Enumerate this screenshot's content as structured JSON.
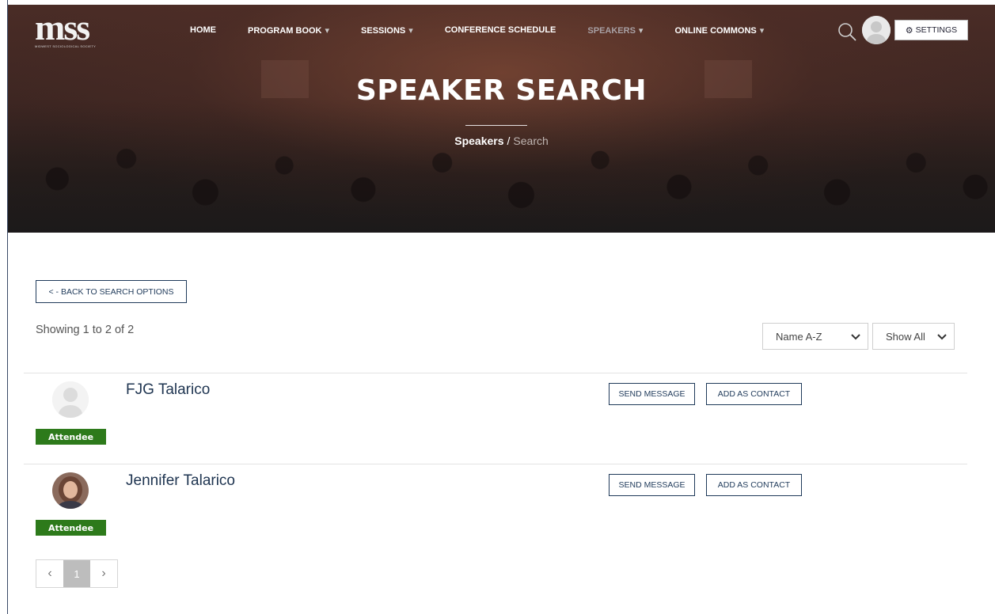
{
  "logo": {
    "text": "mss",
    "subtitle": "MIDWEST SOCIOLOGICAL SOCIETY"
  },
  "nav": {
    "items": [
      {
        "label": "HOME",
        "caret": ""
      },
      {
        "label": "PROGRAM BOOK",
        "caret": "▾"
      },
      {
        "label": "SESSIONS",
        "caret": "▾"
      },
      {
        "label": "CONFERENCE SCHEDULE",
        "caret": ""
      },
      {
        "label": "SPEAKERS",
        "caret": "▾"
      },
      {
        "label": "ONLINE COMMONS",
        "caret": "▾"
      }
    ],
    "settings_label": "SETTINGS",
    "settings_icon": "gear-icon",
    "search_icon": "search-icon"
  },
  "hero": {
    "title": "SPEAKER SEARCH",
    "breadcrumb": {
      "link": "Speakers",
      "separator": "/",
      "current": "Search"
    }
  },
  "content": {
    "back_label": "< - BACK TO SEARCH OPTIONS",
    "showing": "Showing 1 to 2 of 2",
    "sort": {
      "selected": "Name A-Z"
    },
    "filter": {
      "selected": "Show All"
    }
  },
  "speakers": [
    {
      "name": "FJG Talarico",
      "badge": "Attendee",
      "send_label": "SEND MESSAGE",
      "contact_label": "ADD AS CONTACT"
    },
    {
      "name": "Jennifer Talarico",
      "badge": "Attendee",
      "send_label": "SEND MESSAGE",
      "contact_label": "ADD AS CONTACT"
    }
  ],
  "pagination": {
    "prev": "‹",
    "current": "1",
    "next": "›"
  },
  "colors": {
    "badge_green": "#2d7a1b",
    "navy": "#1f3a5a",
    "hero_dark": "#3d2622"
  }
}
